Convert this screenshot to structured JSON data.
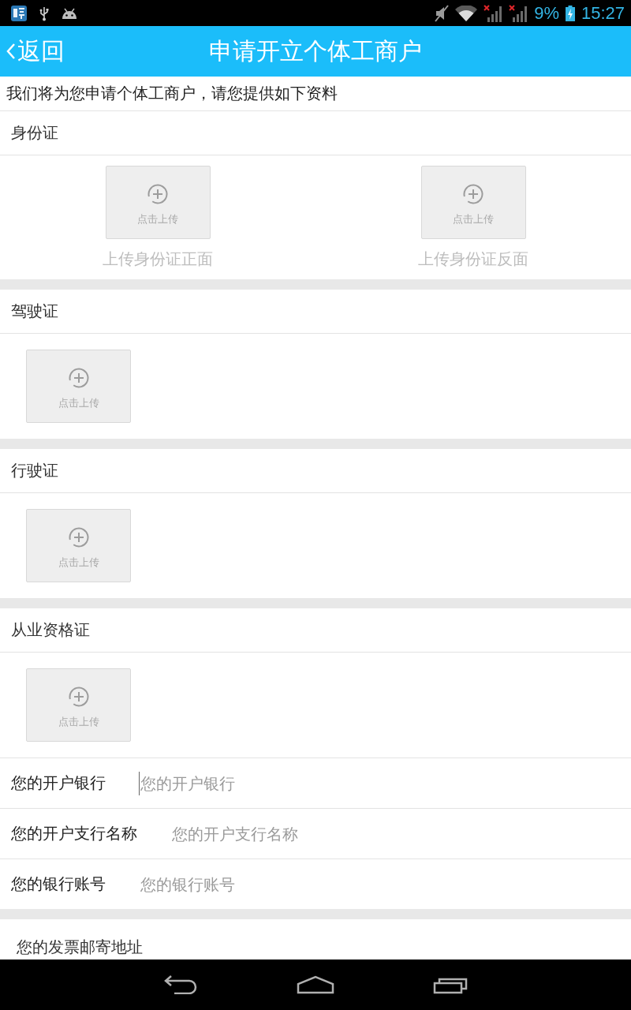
{
  "status_bar": {
    "battery": "9%",
    "time": "15:27"
  },
  "header": {
    "back_label": "返回",
    "title": "申请开立个体工商户"
  },
  "intro": "我们将为您申请个体工商户，请您提供如下资料",
  "sections": [
    {
      "title": "身份证",
      "uploads": [
        {
          "button_label": "点击上传",
          "caption": "上传身份证正面"
        },
        {
          "button_label": "点击上传",
          "caption": "上传身份证反面"
        }
      ]
    },
    {
      "title": "驾驶证",
      "uploads": [
        {
          "button_label": "点击上传"
        }
      ]
    },
    {
      "title": "行驶证",
      "uploads": [
        {
          "button_label": "点击上传"
        }
      ]
    },
    {
      "title": "从业资格证",
      "uploads": [
        {
          "button_label": "点击上传"
        }
      ]
    }
  ],
  "bank_fields": [
    {
      "label": "您的开户银行",
      "placeholder": "您的开户银行",
      "focused": true
    },
    {
      "label": "您的开户支行名称",
      "placeholder": "您的开户支行名称",
      "focused": false
    },
    {
      "label": "您的银行账号",
      "placeholder": "您的银行账号",
      "focused": false
    }
  ],
  "address_section": {
    "title": "您的发票邮寄地址"
  }
}
